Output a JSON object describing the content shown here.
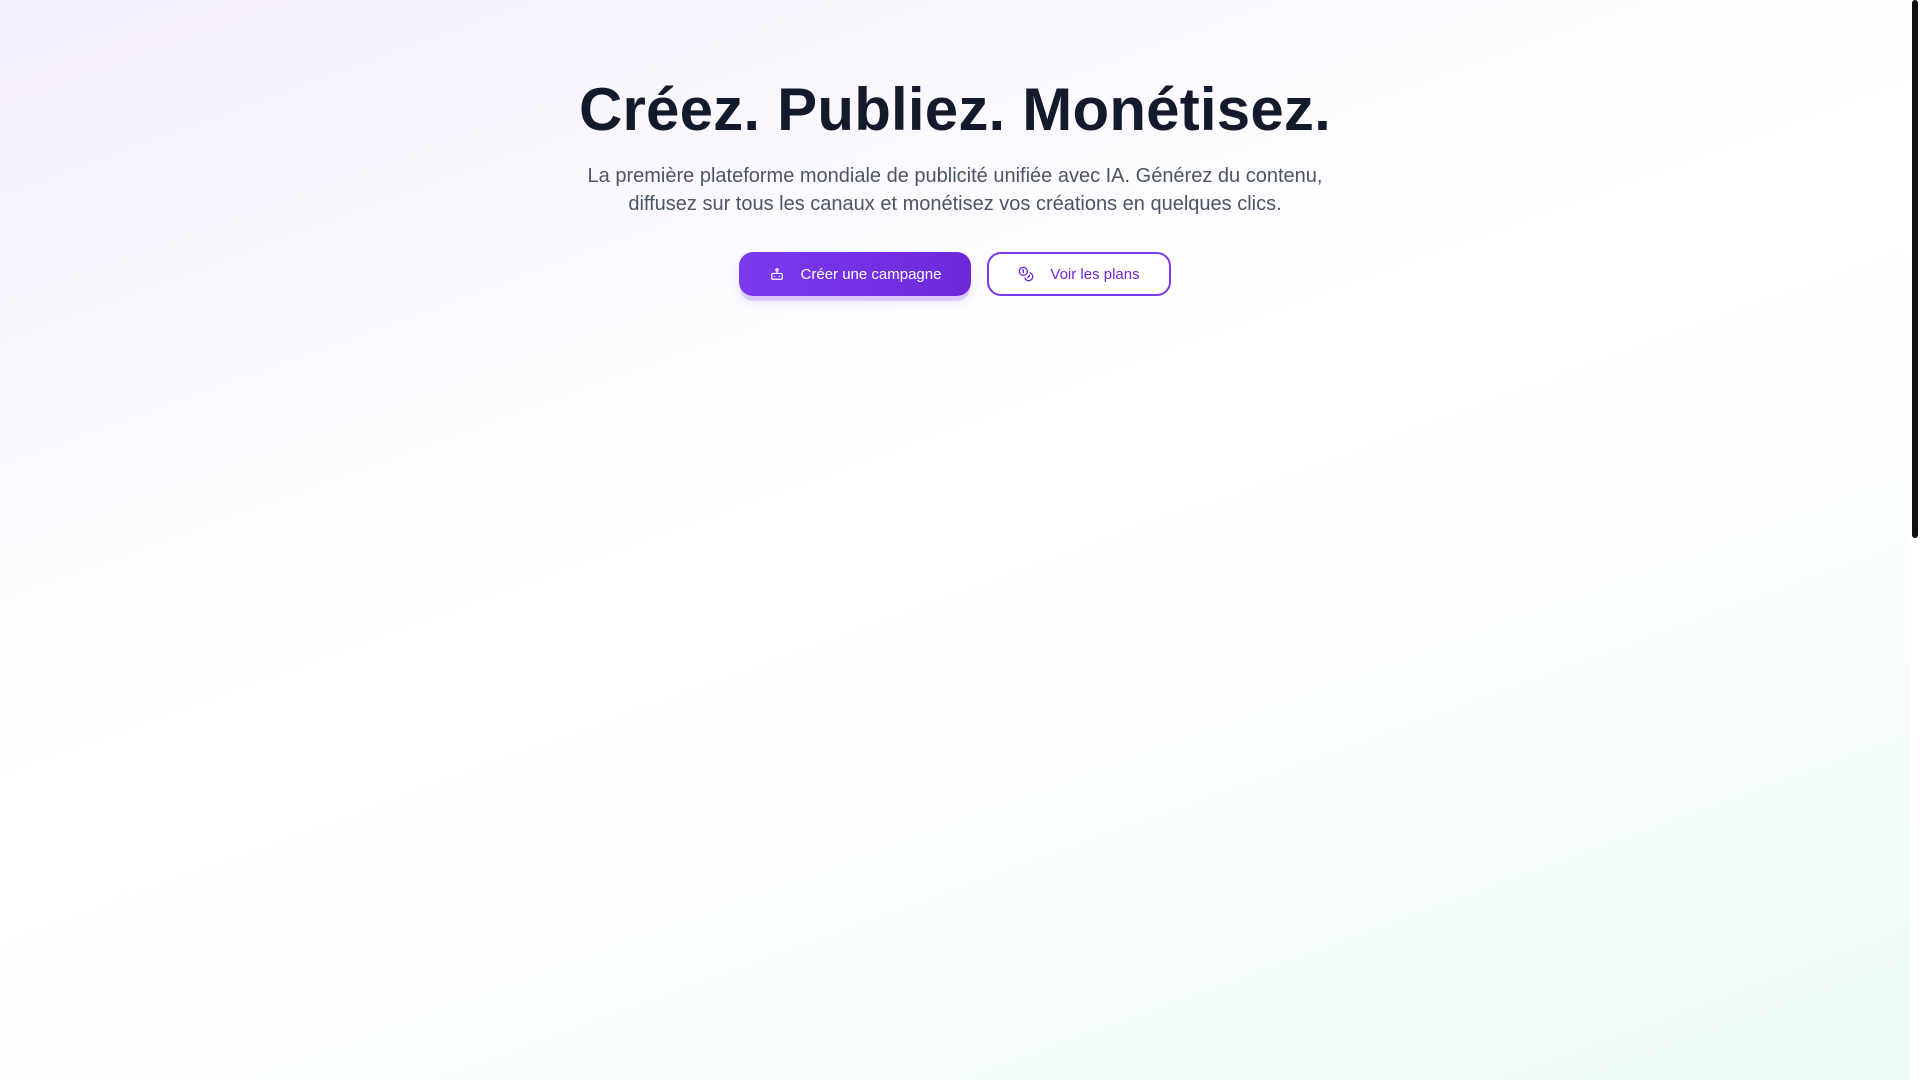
{
  "hero": {
    "title": "Créez. Publiez. Monétisez.",
    "subtitle": "La première plateforme mondiale de publicité unifiée avec IA. Générez du contenu, diffusez sur tous les canaux et monétisez vos créations en quelques clics."
  },
  "cta": {
    "primary": {
      "label": "Créer une campagne",
      "icon": "robot-icon"
    },
    "secondary": {
      "label": "Voir les plans",
      "icon": "coins-icon"
    }
  },
  "colors": {
    "accent": "#7c3aed",
    "accent_dark": "#6d28d9",
    "heading": "#131a2c",
    "body_text": "#4b5563"
  }
}
